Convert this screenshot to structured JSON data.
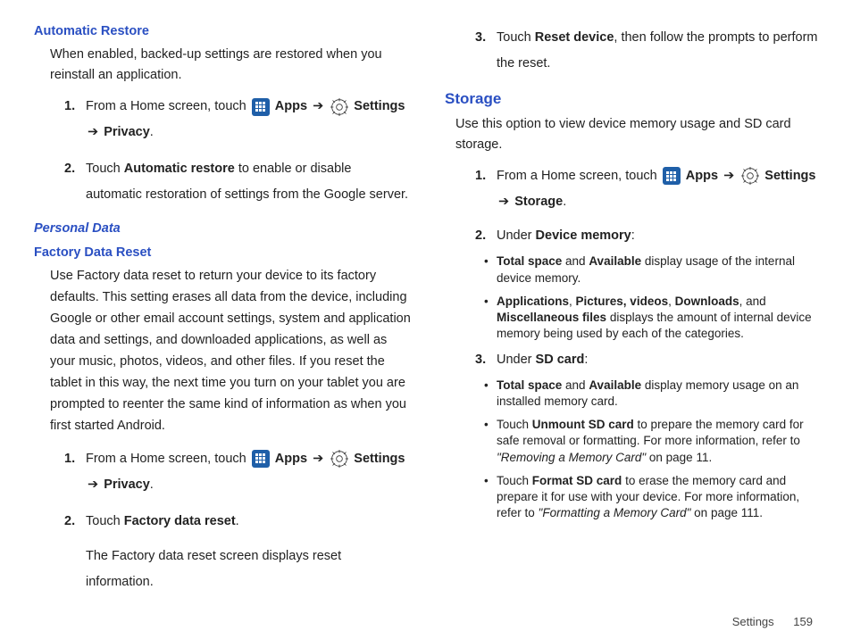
{
  "left": {
    "h_auto_restore": "Automatic Restore",
    "auto_restore_para": "When enabled, backed-up settings are restored when you reinstall an application.",
    "step_home_prefix": "From a Home screen, touch ",
    "apps_label": "Apps",
    "arrow": "➔",
    "settings_label": "Settings",
    "privacy_label": "Privacy",
    "step2_prefix": "Touch ",
    "step2_bold": "Automatic restore",
    "step2_suffix": " to enable or disable automatic restoration of settings from the Google server.",
    "h_personal": "Personal Data",
    "h_factory": "Factory Data Reset",
    "factory_para": "Use Factory data reset to return your device to its factory defaults. This setting erases all data from the device, including Google or other email account settings, system and application data and settings, and downloaded applications, as well as your music, photos, videos, and other files. If you reset the tablet in this way, the next time you turn on your tablet you are prompted to reenter the same kind of information as when you first started Android.",
    "factory_step2_prefix": "Touch ",
    "factory_step2_bold": "Factory data reset",
    "factory_step2_suffix": ".",
    "factory_step2_para": "The Factory data reset screen displays reset information."
  },
  "right": {
    "step3_prefix": "Touch ",
    "step3_bold": "Reset device",
    "step3_suffix": ", then follow the prompts to perform the reset.",
    "h_storage": "Storage",
    "storage_para": "Use this option to view device memory usage and SD card storage.",
    "storage_label": "Storage",
    "step2_prefix": "Under ",
    "step2_bold": "Device memory",
    "b_total": "Total space",
    "b_avail": "Available",
    "dm_b1_mid": " and ",
    "dm_b1_suffix": " display usage of the internal device memory.",
    "b_apps": "Applications",
    "b_pics": "Pictures, videos",
    "b_dl": "Downloads",
    "b_misc": "Miscellaneous files",
    "dm_b2_mid1": ", ",
    "dm_b2_mid2": ", ",
    "dm_b2_mid3": ", and ",
    "dm_b2_suffix": " displays the amount of internal device memory being used by each of the categories.",
    "step3b_prefix": "Under ",
    "step3b_bold": "SD card",
    "sd_b1_suffix": " display memory usage on an installed memory card.",
    "sd_b2_prefix": "Touch ",
    "sd_b2_bold": "Unmount SD card",
    "sd_b2_suffix": " to prepare the memory card for safe removal or formatting. For more information, refer to ",
    "sd_b2_ref": "\"Removing a Memory Card\"",
    "sd_b2_page": " on page 11.",
    "sd_b3_bold": "Format SD card",
    "sd_b3_suffix": " to erase the memory card and prepare it for use with your device. For more information, refer to ",
    "sd_b3_ref": "\"Formatting a Memory Card\"",
    "sd_b3_page": " on page 111."
  },
  "footer": {
    "section": "Settings",
    "page": "159"
  }
}
